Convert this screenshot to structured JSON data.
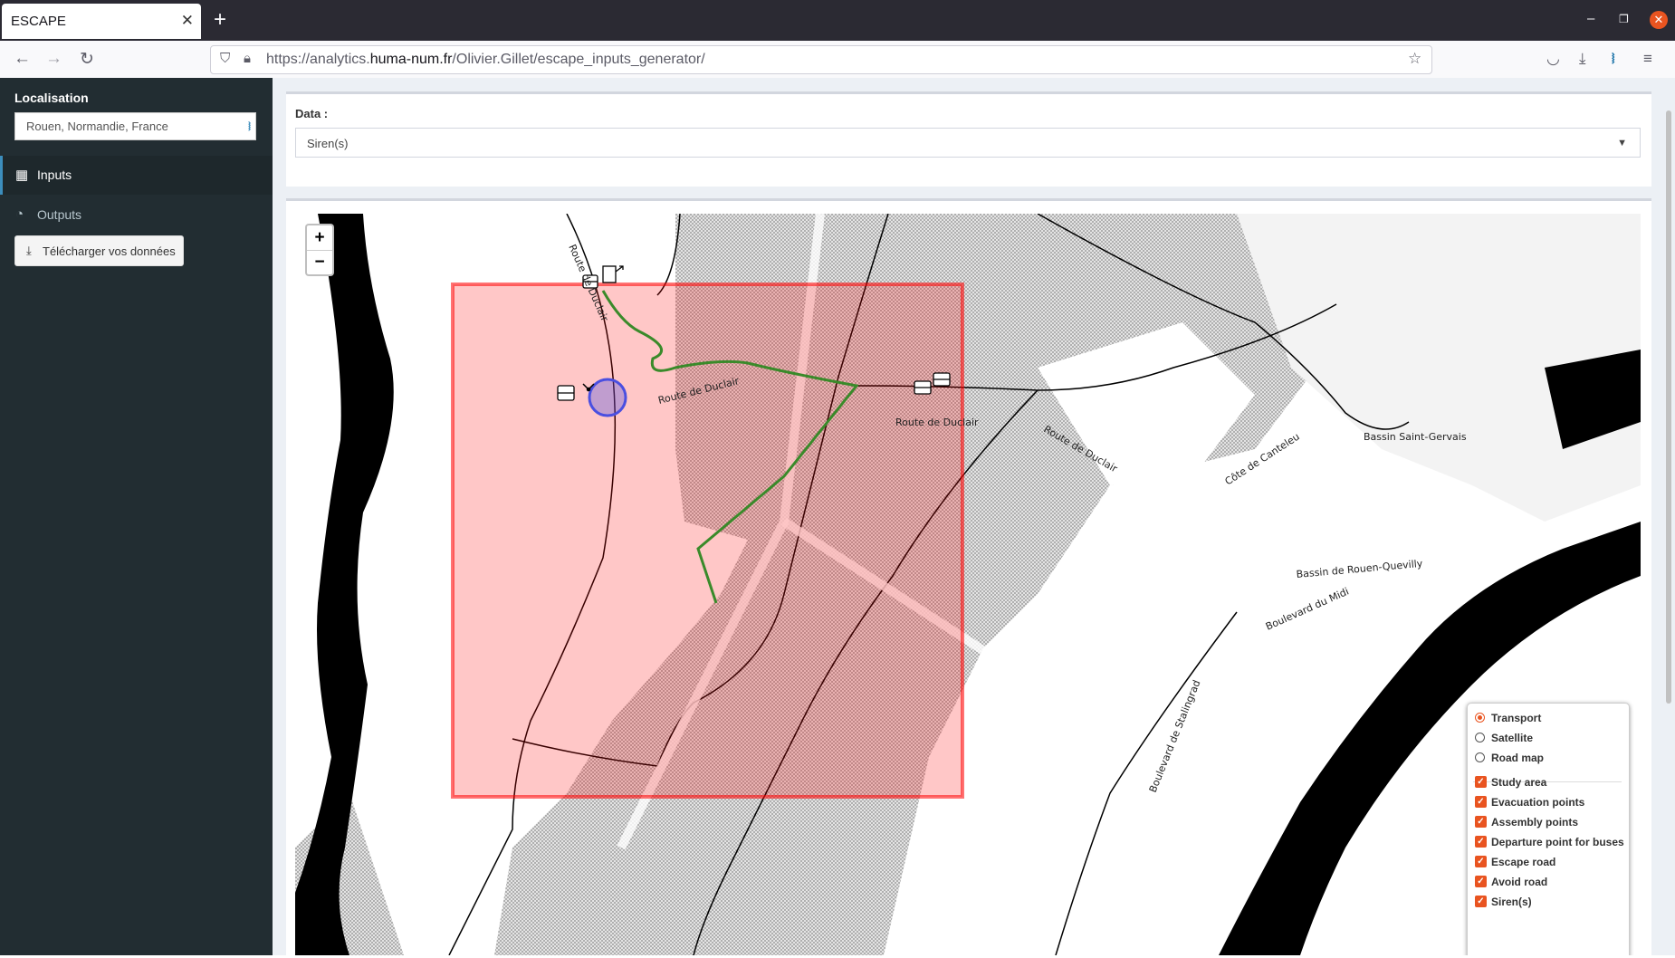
{
  "browser": {
    "tab_title": "ESCAPE",
    "tab_close": "✕",
    "new_tab": "+",
    "url_prefix": "https://analytics.",
    "url_host": "huma-num.fr",
    "url_path": "/Olivier.Gillet/escape_inputs_generator/",
    "back": "←",
    "forward": "→",
    "reload": "↻",
    "minimize": "–",
    "restore": "❐",
    "close": "✕"
  },
  "sidebar": {
    "localisation_label": "Localisation",
    "localisation_value": "Rouen, Normandie, France",
    "menu": [
      {
        "label": "Inputs",
        "icon": "▦"
      },
      {
        "label": "Outputs",
        "icon": "◔"
      }
    ],
    "download_label": "Télécharger vos données",
    "download_icon": "⤓"
  },
  "main": {
    "data_label": "Data :",
    "data_value": "Siren(s)",
    "caret": "▼"
  },
  "map": {
    "zoom_in": "+",
    "zoom_out": "−",
    "labels": {
      "route_duclair_1": "Route de Duclair",
      "route_duclair_2": "Route de Duclair",
      "route_duclair_3": "Route de Duclair",
      "route_duclair_top": "Route de Duclair",
      "cote_canteleu": "Côte de Canteleu",
      "bassin_saint_gervais": "Bassin Saint-Gervais",
      "bassin_rouen_quevilly": "Bassin de Rouen-Quevilly",
      "boulevard_midi": "Boulevard du Midi",
      "boulevard_stalingrad": "Boulevard de Stalingrad"
    },
    "legend": {
      "base_layers": [
        {
          "label": "Transport",
          "selected": true
        },
        {
          "label": "Satellite",
          "selected": false
        },
        {
          "label": "Road map",
          "selected": false
        }
      ],
      "overlays": [
        {
          "label": "Study area",
          "checked": true
        },
        {
          "label": "Evacuation points",
          "checked": true
        },
        {
          "label": "Assembly points",
          "checked": true
        },
        {
          "label": "Departure point for buses",
          "checked": true
        },
        {
          "label": "Escape road",
          "checked": true
        },
        {
          "label": "Avoid road",
          "checked": true
        },
        {
          "label": "Siren(s)",
          "checked": true
        }
      ]
    },
    "colors": {
      "study_area": "#ff0000",
      "escape_road": "#3a8a2a",
      "siren": "#4a4fe0",
      "checkbox": "#e95420"
    }
  }
}
